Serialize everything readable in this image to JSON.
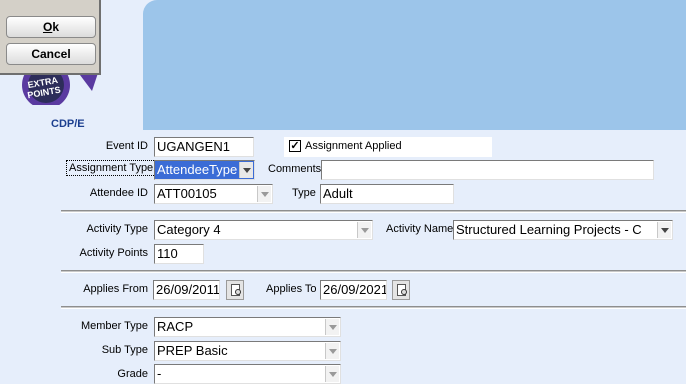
{
  "buttons": {
    "ok": "Ok",
    "ok_mnemonic": "O",
    "ok_rest": "k",
    "cancel": "Cancel"
  },
  "brand": {
    "logo_text": "EXTRA POINTS",
    "caption": "CDP/E"
  },
  "form": {
    "event_id": {
      "label": "Event ID",
      "value": "UGANGEN1"
    },
    "assignment_applied": {
      "label": "Assignment Applied",
      "checked": true
    },
    "assignment_type": {
      "label": "Assignment Type",
      "value": "AttendeeType"
    },
    "comments": {
      "label": "Comments",
      "value": ""
    },
    "attendee_id": {
      "label": "Attendee ID",
      "value": "ATT00105"
    },
    "type": {
      "label": "Type",
      "value": "Adult"
    },
    "activity_type": {
      "label": "Activity Type",
      "value": "Category 4"
    },
    "activity_name": {
      "label": "Activity Name",
      "value": "Structured Learning Projects - C"
    },
    "activity_points": {
      "label": "Activity Points",
      "value": "110"
    },
    "applies_from": {
      "label": "Applies From",
      "value": "26/09/2011"
    },
    "applies_to": {
      "label": "Applies To",
      "value": "26/09/2021"
    },
    "member_type": {
      "label": "Member Type",
      "value": "RACP"
    },
    "sub_type": {
      "label": "Sub Type",
      "value": "PREP Basic"
    },
    "grade": {
      "label": "Grade",
      "value": "-"
    }
  },
  "icons": {
    "check": "checkmark-icon",
    "dropdown": "chevron-down-icon",
    "calendar": "calendar-lookup-icon"
  },
  "colors": {
    "banner": "#9cc5ea",
    "background": "#e6eefb",
    "selection": "#3b6cd6",
    "logo_purple": "#5a3aa0"
  }
}
